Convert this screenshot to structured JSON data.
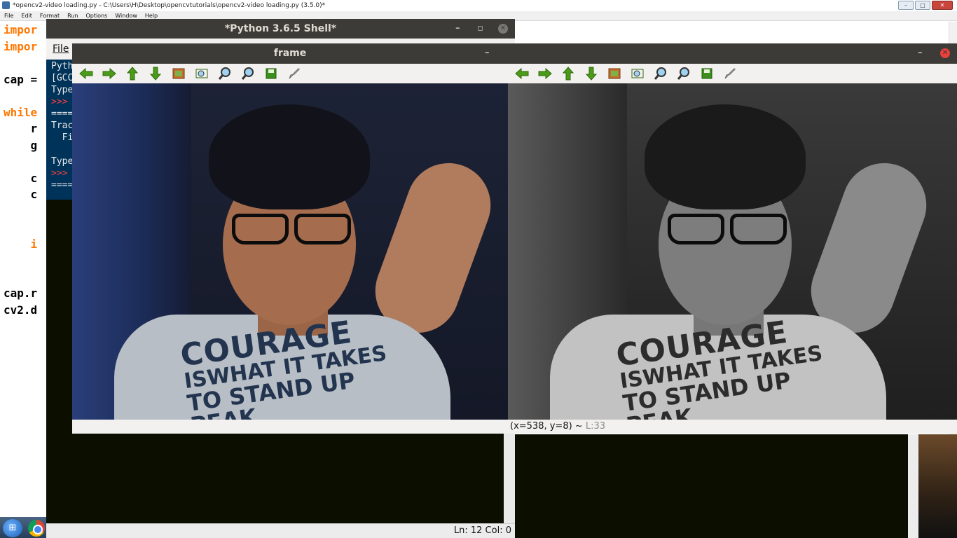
{
  "editor": {
    "title": "*opencv2-video loading.py - C:\\Users\\H\\Desktop\\opencvtutorials\\opencv2-video loading.py (3.5.0)*",
    "menu": [
      "File",
      "Edit",
      "Format",
      "Run",
      "Options",
      "Window",
      "Help"
    ],
    "window_buttons": {
      "minimize": "–",
      "maximize": "□",
      "close": "✕"
    },
    "code_lines": [
      {
        "kw": "impor",
        "rest": ""
      },
      {
        "kw": "impor",
        "rest": ""
      },
      {
        "kw": "",
        "rest": "cap ="
      },
      {
        "kw": "while",
        "rest": ""
      },
      {
        "kw": "",
        "rest": "    r"
      },
      {
        "kw": "",
        "rest": "    g"
      },
      {
        "kw": "",
        "rest": "    c"
      },
      {
        "kw": "",
        "rest": "    c"
      },
      {
        "kw": "    i",
        "rest": ""
      },
      {
        "kw": "",
        "rest": "cap.r"
      },
      {
        "kw": "",
        "rest": "cv2.d"
      }
    ]
  },
  "shell": {
    "title": "*Python 3.6.5 Shell*",
    "menu_file": "File",
    "lines": [
      "Pyth",
      "[GCC",
      "Type",
      ">>>",
      "====",
      "Trac",
      "  Fi",
      "Type",
      ">>>",
      "===="
    ],
    "status": "Ln: 12  Col: 0"
  },
  "frame_window": {
    "title": "frame",
    "minimize": "–"
  },
  "gray_window": {
    "title": "",
    "minimize": "–",
    "status_coords": "(x=538, y=8) ~",
    "status_level": "L:33"
  },
  "toolbar_icons": [
    "arrow-left-icon",
    "arrow-right-icon",
    "arrow-up-icon",
    "arrow-down-icon",
    "image-icon",
    "zoom-fit-icon",
    "zoom-in-icon",
    "zoom-out-icon",
    "save-icon",
    "brush-icon"
  ],
  "shirt_text": {
    "line1": "COURAGE",
    "line2": "ISWHAT IT TAKES",
    "line3": "TO STAND UP",
    "line4": "PEAK"
  },
  "colors": {
    "titlebar": "#3c3b37",
    "close_red": "#e9403c",
    "keyword_orange": "#ff7700",
    "shell_bg": "#0c0f00",
    "shell_text_bg": "#00335a"
  }
}
